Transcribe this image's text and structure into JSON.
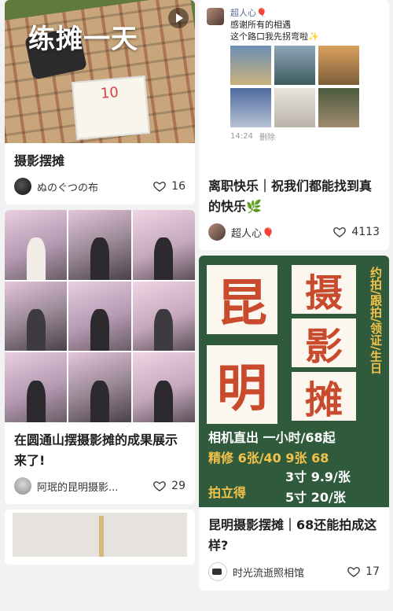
{
  "left": {
    "card1": {
      "overlay": "练摊一天",
      "sign_text": "10",
      "title": "摄影摆摊",
      "author": "ぬのぐつの布",
      "likes": "16"
    },
    "card2": {
      "title": "在圆通山摆摄影摊的成果展示来了!",
      "author": "阿珉的昆明摄影...",
      "likes": "29"
    }
  },
  "right": {
    "card1": {
      "wechat_name": "超人心🎈",
      "wechat_line1": "感谢所有的相遇",
      "wechat_line2": "这个路口我先拐弯啦✨",
      "wechat_time": "14:24",
      "wechat_delete": "删除",
      "title": "离职快乐｜祝我们都能找到真的快乐🌿",
      "author": "超人心🎈",
      "likes": "4113"
    },
    "card2": {
      "poster": {
        "kun": "昆",
        "ming": "明",
        "she": "摄",
        "ying": "影",
        "tan": "摊",
        "side": "约拍/跟拍/领证/生日",
        "line1": "相机直出  一小时/68起",
        "line2": "精修  6张/40  9张 68",
        "line3": "3寸 9.9/张",
        "line4": "拍立得",
        "line5": "5寸 20/张"
      },
      "title": "昆明摄影摆摊｜68还能拍成这样?",
      "author": "时光流逝照相馆",
      "likes": "17"
    }
  },
  "colors": {
    "poster_green": "#2f5b3c",
    "poster_red": "#c94a2c",
    "poster_yellow": "#f3c24b"
  }
}
